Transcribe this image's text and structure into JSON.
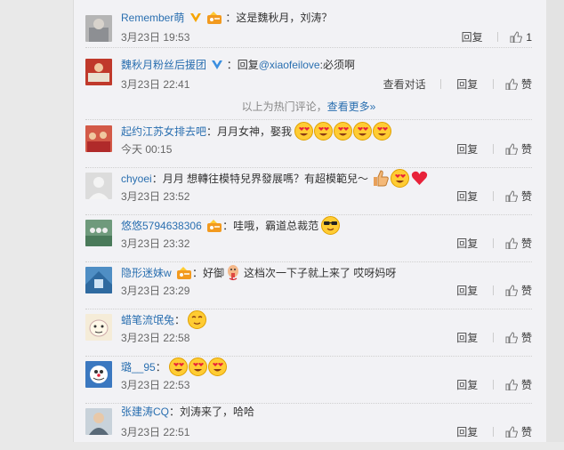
{
  "comments": [
    {
      "user": "Remember萌",
      "verified": "gold",
      "has_hat": true,
      "text": "：这是魏秋月，刘涛？",
      "time": "3月23日 19:53",
      "reply": "回复",
      "like": "1",
      "avatar": "#9aa0a6"
    },
    {
      "user": "魏秋月粉丝后援团",
      "verified": "blue",
      "has_hat": false,
      "text_prefix": "：回复",
      "mention": "@xiaofeilove",
      "text": ":必须啊",
      "time": "3月23日 22:41",
      "view_dialog": "查看对话",
      "reply": "回复",
      "like": "赞",
      "avatar": "#c0392b"
    },
    {
      "user": "起约江苏女排去吧",
      "verified": "",
      "has_hat": false,
      "text": "：月月女神，娶我",
      "emoji": [
        "heart-eyes",
        "heart-eyes",
        "heart-eyes",
        "heart-eyes",
        "heart-eyes"
      ],
      "time": "今天 00:15",
      "reply": "回复",
      "like": "赞",
      "avatar": "#b0413e"
    },
    {
      "user": "chyoei",
      "verified": "",
      "has_hat": false,
      "text": "：月月 想轉往模特兒界發展嗎？有超模範兒～",
      "emoji": [
        "thumbs-up",
        "heart-eyes",
        "heart"
      ],
      "time": "3月23日 23:52",
      "reply": "回复",
      "like": "赞",
      "avatar": "#dcdcdc"
    },
    {
      "user": "悠悠5794638306",
      "verified": "",
      "has_hat": true,
      "text": "：哇哦，霸道总裁范",
      "emoji": [
        "sunglasses"
      ],
      "time": "3月23日 23:32",
      "reply": "回复",
      "like": "赞",
      "avatar": "#5c8a6a"
    },
    {
      "user": "隐形迷妹w",
      "verified": "",
      "has_hat": true,
      "text_prefix": "：好御",
      "text": "这档次一下子就上来了 哎呀妈呀",
      "emoji_mid": [
        "nosebleed"
      ],
      "time": "3月23日 23:29",
      "reply": "回复",
      "like": "赞",
      "avatar": "#3a7ab0"
    },
    {
      "user": "蜡笔流氓兔",
      "verified": "",
      "has_hat": false,
      "text": "：",
      "emoji": [
        "smirk"
      ],
      "time": "3月23日 22:58",
      "reply": "回复",
      "like": "赞",
      "avatar": "#e8d8b0"
    },
    {
      "user": "璐__95",
      "verified": "",
      "has_hat": false,
      "text": "：",
      "emoji": [
        "heart-eyes",
        "heart-eyes",
        "heart-eyes"
      ],
      "time": "3月23日 22:53",
      "reply": "回复",
      "like": "赞",
      "avatar": "#3b78c0"
    },
    {
      "user": "张建涛CQ",
      "verified": "",
      "has_hat": false,
      "text": "：刘涛来了，哈哈",
      "time": "3月23日 22:51",
      "reply": "回复",
      "like": "赞",
      "avatar": "#8a9aa8"
    }
  ],
  "divider": {
    "text": "以上为热门评论，",
    "more": "查看更多»"
  },
  "colors": {
    "link": "#2a6fb0",
    "gold": "#f6a500",
    "blue": "#3b8fe0",
    "emoji": "#ffcc33"
  }
}
